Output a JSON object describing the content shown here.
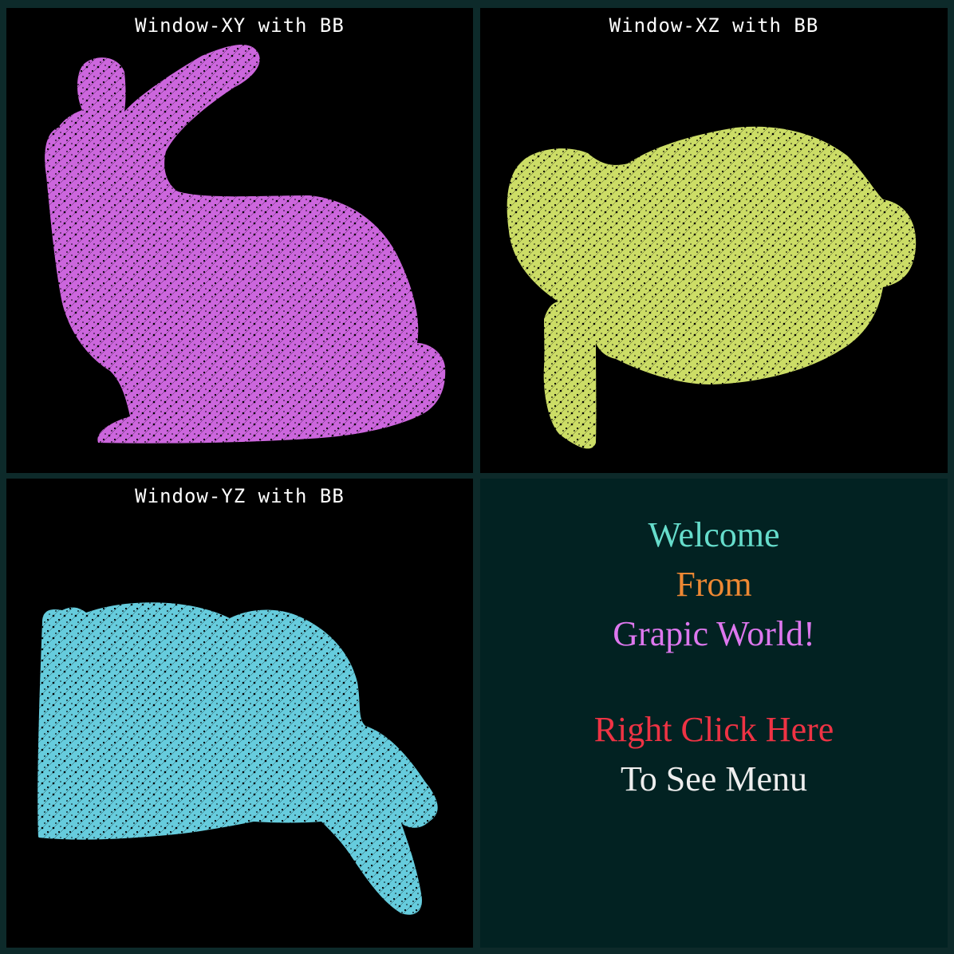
{
  "viewports": [
    {
      "id": "xy",
      "title": "Window-XY with BB",
      "mesh_color": "#cc66dd"
    },
    {
      "id": "xz",
      "title": "Window-XZ with BB",
      "mesh_color": "#ccdd66"
    },
    {
      "id": "yz",
      "title": "Window-YZ with BB",
      "mesh_color": "#66ccdd"
    }
  ],
  "menu_panel": {
    "line1": "Welcome",
    "line2": "From",
    "line3": "Grapic World!",
    "line4": "Right Click Here",
    "line5": "To See Menu",
    "colors": {
      "line1": "#66ddcc",
      "line2": "#ee8833",
      "line3": "#dd77ee",
      "line4": "#ee3344",
      "line5": "#eeeeee"
    }
  }
}
